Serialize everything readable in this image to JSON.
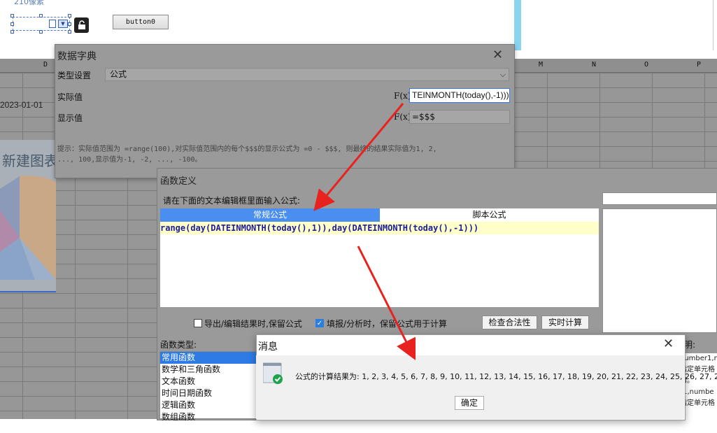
{
  "designer": {
    "cut_text": "210像素",
    "button0_label": "button0"
  },
  "sheet": {
    "columns": [
      {
        "label": "D"
      },
      {
        "label": "M"
      },
      {
        "label": "N"
      },
      {
        "label": "O"
      },
      {
        "label": "P"
      }
    ],
    "date_cell": "2023-01-01",
    "chart_title": "新建图表"
  },
  "data_dict": {
    "title": "数据字典",
    "type_label": "类型设置",
    "type_value": "公式",
    "actual_label": "实际值",
    "actual_value": "TEINMONTH(today(),-1)))",
    "display_label": "显示值",
    "display_value": "=$$$",
    "fx_label": "F(x)",
    "hint_line1": "提示：实际值范围为 =range(100),对实际值范围内的每个$$$的显示公式为 =0 - $$$, 则最终的结果实际值为1, 2,",
    "hint_line2": "..., 100,显示值为-1, -2, ..., -100。"
  },
  "func_def": {
    "title": "函数定义",
    "prompt": "请在下面的文本编辑框里面输入公式:",
    "tab_normal": "常规公式",
    "tab_script": "脚本公式",
    "code": "range(day(DATEINMONTH(today(),1)),day(DATEINMONTH(today(),-1)))",
    "export_keep_label": "导出/编辑结果时,保留公式",
    "fill_keep_label": "填报/分析时，保留公式用于计算",
    "check_btn": "检查合法性",
    "realtime_btn": "实时计算",
    "func_type_label": "函数类型:",
    "func_types": [
      "常用函数",
      "数学和三角函数",
      "文本函数",
      "时间日期函数",
      "逻辑函数",
      "数组函数"
    ],
    "desc_label": "明:",
    "desc_lines": [
      "number1,n",
      "指定单元格",
      "和。",
      "r1,numbe",
      "指定单元格"
    ]
  },
  "message": {
    "title": "消息",
    "text": "公式的计算结果为: 1, 2, 3, 4, 5, 6, 7, 8, 9, 10, 11, 12, 13, 14, 15, 16, 17, 18, 19, 20, 21, 22, 23, 24, 25, 26, 27, 28",
    "ok_label": "确定"
  },
  "colors": {
    "accent": "#4a8ef0",
    "arrow": "#e8231f",
    "success": "#1fa34a"
  }
}
